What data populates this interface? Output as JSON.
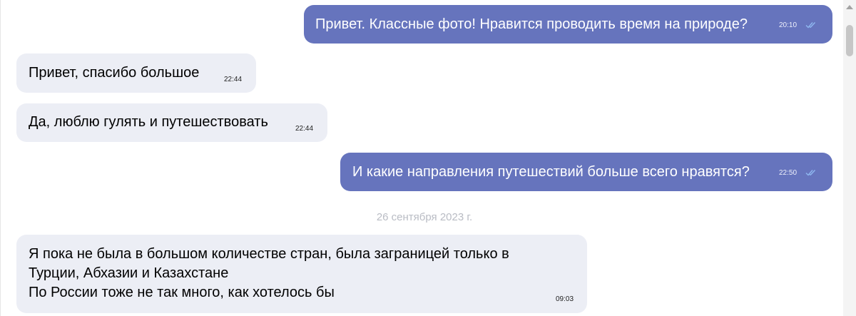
{
  "messages": [
    {
      "direction": "out",
      "text": "Привет. Классные фото! Нравится проводить время на природе?",
      "time": "20:10",
      "status_icon": "double-check-icon"
    },
    {
      "direction": "in",
      "text": "Привет, спасибо большое",
      "time": "22:44"
    },
    {
      "direction": "in",
      "text": "Да, люблю гулять и путешествовать",
      "time": "22:44"
    },
    {
      "direction": "out",
      "text": "И какие направления путешествий больше всего нравятся?",
      "time": "22:50",
      "status_icon": "double-check-icon"
    },
    {
      "direction": "in",
      "lines": [
        "Я пока не была в большом количестве стран, была заграницей только в",
        "Турции, Абхазии и Казахстане",
        "По России тоже не так много, как хотелось бы"
      ],
      "time": "09:03"
    }
  ],
  "date_separator": "26 сентября 2023 г.",
  "colors": {
    "outgoing_bubble": "#6674bd",
    "incoming_bubble": "#eceef5",
    "check_marks": "#8fb7f0"
  }
}
